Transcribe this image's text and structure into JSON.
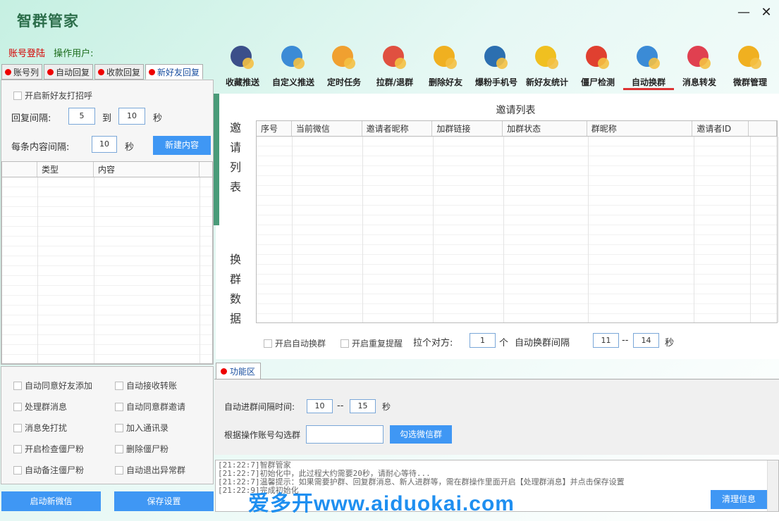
{
  "app": {
    "title": "智群管家",
    "minimize": "—",
    "close": "✕"
  },
  "account": {
    "login_label": "账号登陆",
    "user_label": "操作用户:"
  },
  "left_tabs": [
    {
      "label": "账号列"
    },
    {
      "label": "自动回复"
    },
    {
      "label": "收款回复"
    },
    {
      "label": "新好友回复"
    }
  ],
  "greeting": {
    "enable_label": "开启新好友打招呼",
    "reply_interval_label": "回复间隔:",
    "reply_from": "5",
    "to_label": "到",
    "reply_to": "10",
    "sec": "秒",
    "each_interval_label": "每条内容间隔:",
    "each_interval": "10",
    "new_content_btn": "新建内容",
    "columns": [
      "类型",
      "内容"
    ]
  },
  "toolbar": [
    {
      "label": "收藏推送",
      "icon": "bookmark-clock-icon"
    },
    {
      "label": "自定义推送",
      "icon": "chat-stars-icon"
    },
    {
      "label": "定时任务",
      "icon": "user-chat-icon"
    },
    {
      "label": "拉群/退群",
      "icon": "org-chart-icon"
    },
    {
      "label": "删除好友",
      "icon": "pacman-icon"
    },
    {
      "label": "爆粉手机号",
      "icon": "search-list-icon"
    },
    {
      "label": "新好友统计",
      "icon": "leaf-stats-icon"
    },
    {
      "label": "僵尸检测",
      "icon": "target-icon"
    },
    {
      "label": "自动换群",
      "icon": "sliders-icon"
    },
    {
      "label": "消息转发",
      "icon": "dots-icon"
    },
    {
      "label": "微群管理",
      "icon": "gear-icon"
    }
  ],
  "invite": {
    "side_title": "邀请列表",
    "side_title2": "换群数据",
    "table_title": "邀请列表",
    "columns": [
      "序号",
      "当前微信",
      "邀请者昵称",
      "加群链接",
      "加群状态",
      "群昵称",
      "邀请者ID"
    ],
    "auto_switch_label": "开启自动换群",
    "repeat_remind_label": "开启重复提醒",
    "pull_label": "拉个对方:",
    "pull_count": "1",
    "unit": "个",
    "switch_interval_label": "自动换群间隔",
    "switch_from": "11",
    "dash": "--",
    "switch_to": "14",
    "sec": "秒"
  },
  "func": {
    "tab_label": "功能区",
    "join_interval_label": "自动进群间隔时间:",
    "join_from": "10",
    "dash": "--",
    "join_to": "15",
    "sec": "秒",
    "select_label": "根据操作账号勾选群",
    "select_placeholder": "",
    "select_btn": "勾选微信群"
  },
  "options": [
    [
      "自动同意好友添加",
      "自动接收转账"
    ],
    [
      "处理群消息",
      "自动同意群邀请"
    ],
    [
      "消息免打扰",
      "加入通讯录"
    ],
    [
      "开启检查僵尸粉",
      "删除僵尸粉"
    ],
    [
      "自动备注僵尸粉",
      "自动退出异常群"
    ]
  ],
  "buttons": {
    "start_wechat": "启动新微信",
    "save": "保存设置",
    "clear": "清理信息"
  },
  "log": [
    "[21:22:7]智群管家",
    "[21:22:7]初始化中，此过程大约需要20秒，请耐心等待...",
    "[21:22:7]温馨提示：如果需要护群、回复群消息、新人进群等，需在群操作里面开启【处理群消息】并点击保存设置",
    "[21:22:9]完成初始化"
  ],
  "watermark": "爱多开www.aiduokai.com"
}
